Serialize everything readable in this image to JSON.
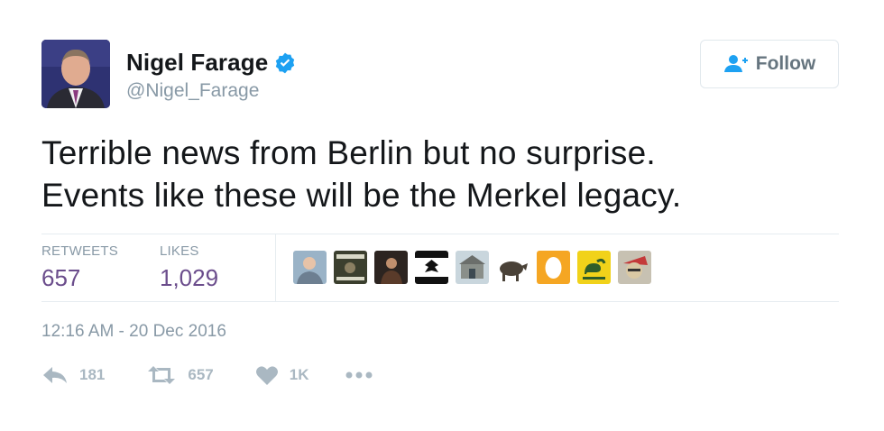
{
  "author": {
    "display_name": "Nigel Farage",
    "handle": "@Nigel_Farage",
    "verified": true,
    "avatar_icon": "profile-photo"
  },
  "follow_button": {
    "label": "Follow",
    "icon": "add-user-icon"
  },
  "tweet": {
    "lines": [
      "Terrible news from Berlin but no surprise.",
      "Events like these will be the Merkel legacy."
    ]
  },
  "stats": {
    "retweets_label": "RETWEETS",
    "retweets_value": "657",
    "likes_label": "LIKES",
    "likes_value": "1,029"
  },
  "likers": [
    {
      "icon": "liker-avatar-1",
      "color": "#9ab3c7"
    },
    {
      "icon": "liker-avatar-2",
      "color": "#3b3f2e"
    },
    {
      "icon": "liker-avatar-3",
      "color": "#5a3b2a"
    },
    {
      "icon": "liker-avatar-4",
      "color": "#ffffff"
    },
    {
      "icon": "liker-avatar-5",
      "color": "#b8c4c9"
    },
    {
      "icon": "liker-avatar-6",
      "color": "#ffffff"
    },
    {
      "icon": "liker-avatar-7",
      "color": "#f5a623"
    },
    {
      "icon": "liker-avatar-8",
      "color": "#f1d21a"
    },
    {
      "icon": "liker-avatar-9",
      "color": "#c7c1b2"
    }
  ],
  "timestamp": "12:16 AM - 20 Dec 2016",
  "actions": {
    "reply_count": "181",
    "retweet_count": "657",
    "like_count": "1K",
    "more_icon": "more-icon"
  },
  "colors": {
    "text": "#14171a",
    "muted": "#8899a6",
    "stat_value": "#6b4d8c",
    "verified_blue": "#1da1f2",
    "action_gray": "#aab8c2"
  }
}
